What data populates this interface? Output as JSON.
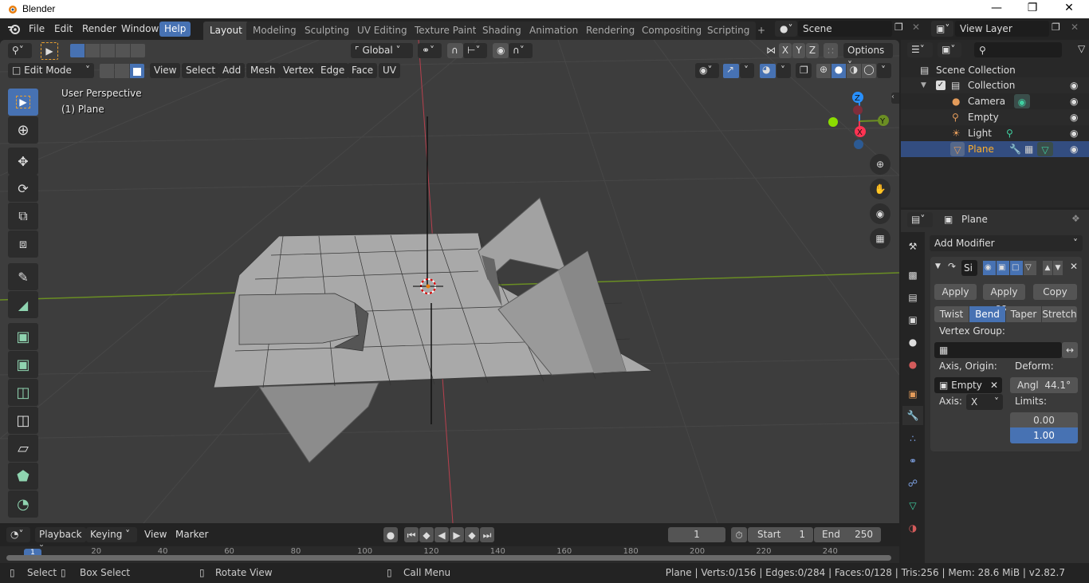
{
  "window": {
    "title": "Blender",
    "controls": [
      "minimize",
      "restore",
      "close"
    ]
  },
  "menu": {
    "items": [
      "File",
      "Edit",
      "Render",
      "Window",
      "Help"
    ],
    "active": "Help"
  },
  "workspaces": {
    "tabs": [
      "Layout",
      "Modeling",
      "Sculpting",
      "UV Editing",
      "Texture Paint",
      "Shading",
      "Animation",
      "Rendering",
      "Compositing",
      "Scripting"
    ],
    "active": "Layout",
    "add_label": "+"
  },
  "scene": {
    "name": "Scene",
    "view_layer": "View Layer"
  },
  "viewport_header": {
    "mode": "Edit Mode",
    "menus": [
      "View",
      "Select",
      "Add",
      "Mesh",
      "Vertex",
      "Edge",
      "Face",
      "UV"
    ],
    "orientation": "Global",
    "mirror_axes": [
      "X",
      "Y",
      "Z"
    ],
    "options_label": "Options"
  },
  "viewport": {
    "overlay_text_1": "User Perspective",
    "overlay_text_2": "(1) Plane",
    "gizmo_axes": [
      "Z",
      "Y",
      "X"
    ],
    "colors": {
      "x": "#ff3352",
      "y": "#8bdc00",
      "z": "#2890ff",
      "bg": "#3d3d3d",
      "mesh": "#a8a8a8"
    }
  },
  "toolbar": {
    "tools": [
      "select-box",
      "cursor",
      "move",
      "rotate",
      "scale",
      "transform",
      "annotate",
      "measure",
      "extrude-region",
      "inset-faces",
      "bevel",
      "loop-cut",
      "knife",
      "poly-build",
      "spin"
    ]
  },
  "outliner": {
    "root": "Scene Collection",
    "collection": "Collection",
    "items": [
      {
        "name": "Camera",
        "icon": "camera-icon"
      },
      {
        "name": "Empty",
        "icon": "empty-icon"
      },
      {
        "name": "Light",
        "icon": "light-icon"
      },
      {
        "name": "Plane",
        "icon": "mesh-icon",
        "selected": true
      }
    ]
  },
  "properties": {
    "object_name": "Plane",
    "add_modifier_label": "Add Modifier",
    "modifier_name": "Si",
    "apply_label": "Apply",
    "apply_as_label": "Apply as..",
    "copy_label": "Copy",
    "deform_modes": [
      "Twist",
      "Bend",
      "Taper",
      "Stretch"
    ],
    "active_mode": "Bend",
    "vertex_group_label": "Vertex Group:",
    "vertex_group_value": "",
    "axis_origin_label": "Axis, Origin:",
    "origin_value": "Empty",
    "deform_label": "Deform:",
    "angle_label": "Angl",
    "angle_value": "44.1°",
    "axis_label": "Axis:",
    "axis_value": "X",
    "limits_label": "Limits:",
    "limit_min": "0.00",
    "limit_max": "1.00"
  },
  "timeline": {
    "menus": [
      "Playback",
      "Keying",
      "View",
      "Marker"
    ],
    "current_frame": "1",
    "start_label": "Start",
    "start_value": "1",
    "end_label": "End",
    "end_value": "250",
    "ticks": [
      "1",
      "20",
      "40",
      "60",
      "80",
      "100",
      "120",
      "140",
      "160",
      "180",
      "200",
      "220",
      "240"
    ]
  },
  "statusbar": {
    "select": "Select",
    "box_select": "Box Select",
    "rotate_view": "Rotate View",
    "call_menu": "Call Menu",
    "stats": "Plane | Verts:0/156 | Edges:0/284 | Faces:0/128 | Tris:256 | Mem: 28.6 MiB | v2.82.7"
  }
}
